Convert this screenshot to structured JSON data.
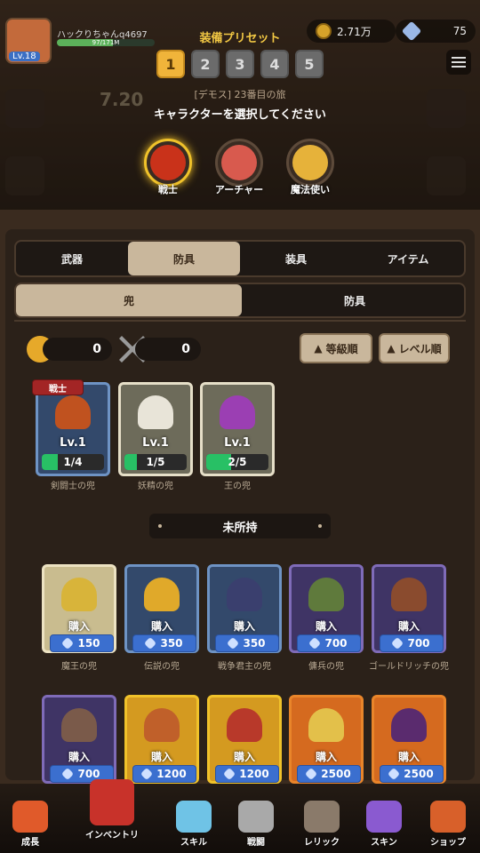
{
  "header": {
    "player_name": "ハックりちゃんq4697",
    "level": "Lv.18",
    "xp_text": "97/171M",
    "xp_fraction": 0.57,
    "gold": "2.71万",
    "gems": "75",
    "stage_text": "[デモス] 23番目の旅",
    "timer": "7.20"
  },
  "preset": {
    "title": "装備プリセット",
    "slots": [
      "1",
      "2",
      "3",
      "4",
      "5"
    ],
    "active_index": 0,
    "select_prompt": "キャラクターを選択してください"
  },
  "characters": [
    {
      "label": "戦士",
      "color": "#c9321a",
      "active": true
    },
    {
      "label": "アーチャー",
      "color": "#d85a4e",
      "active": false
    },
    {
      "label": "魔法使い",
      "color": "#e6b23a",
      "active": false
    }
  ],
  "tabs": [
    "武器",
    "防具",
    "装具",
    "アイテム"
  ],
  "active_tab": 1,
  "subtabs": [
    "兜",
    "防具"
  ],
  "active_subtab": 0,
  "resources": {
    "bell_count": "0",
    "swords_count": "0"
  },
  "sort": {
    "grade": "等級順",
    "level": "レベル順"
  },
  "owned": [
    {
      "name": "剣闘士の兜",
      "level": "Lv.1",
      "progress": "1/4",
      "fill": 0.25,
      "rarity": "blue",
      "helm_color": "#c0521f",
      "tag": "戦士"
    },
    {
      "name": "妖精の兜",
      "level": "Lv.1",
      "progress": "1/5",
      "fill": 0.2,
      "rarity": "white",
      "helm_color": "#e8e4d8"
    },
    {
      "name": "王の兜",
      "level": "Lv.1",
      "progress": "2/5",
      "fill": 0.4,
      "rarity": "white",
      "helm_color": "#9b3fb3"
    }
  ],
  "unowned_title": "未所持",
  "buy_label": "購入",
  "unowned": [
    {
      "name": "魔王の兜",
      "price": "150",
      "rarity": "cream",
      "helm_color": "#d8b43a"
    },
    {
      "name": "伝説の兜",
      "price": "350",
      "rarity": "blue",
      "helm_color": "#e0a92a"
    },
    {
      "name": "戦争君主の兜",
      "price": "350",
      "rarity": "blue",
      "helm_color": "#3a3f6e"
    },
    {
      "name": "傭兵の兜",
      "price": "700",
      "rarity": "purple",
      "helm_color": "#5f7a3c"
    },
    {
      "name": "ゴールドリッチの兜",
      "price": "700",
      "rarity": "purple",
      "helm_color": "#8a4b2e"
    },
    {
      "name": "",
      "price": "700",
      "rarity": "purple",
      "helm_color": "#7a5a4a"
    },
    {
      "name": "",
      "price": "1200",
      "rarity": "gold",
      "helm_color": "#c0602a"
    },
    {
      "name": "",
      "price": "1200",
      "rarity": "gold",
      "helm_color": "#b8392a"
    },
    {
      "name": "",
      "price": "2500",
      "rarity": "orange",
      "helm_color": "#e3c04a"
    },
    {
      "name": "",
      "price": "2500",
      "rarity": "orange",
      "helm_color": "#5a2b6e"
    }
  ],
  "nav": [
    {
      "label": "成長",
      "color": "#e05a2a"
    },
    {
      "label": "インベントリ",
      "color": "#c8322a"
    },
    {
      "label": "スキル",
      "color": "#6fc3e6"
    },
    {
      "label": "戦闘",
      "color": "#a9a9a9"
    },
    {
      "label": "レリック",
      "color": "#8a7a6a"
    },
    {
      "label": "スキン",
      "color": "#8a5ad0"
    },
    {
      "label": "ショップ",
      "color": "#d8602a"
    }
  ]
}
